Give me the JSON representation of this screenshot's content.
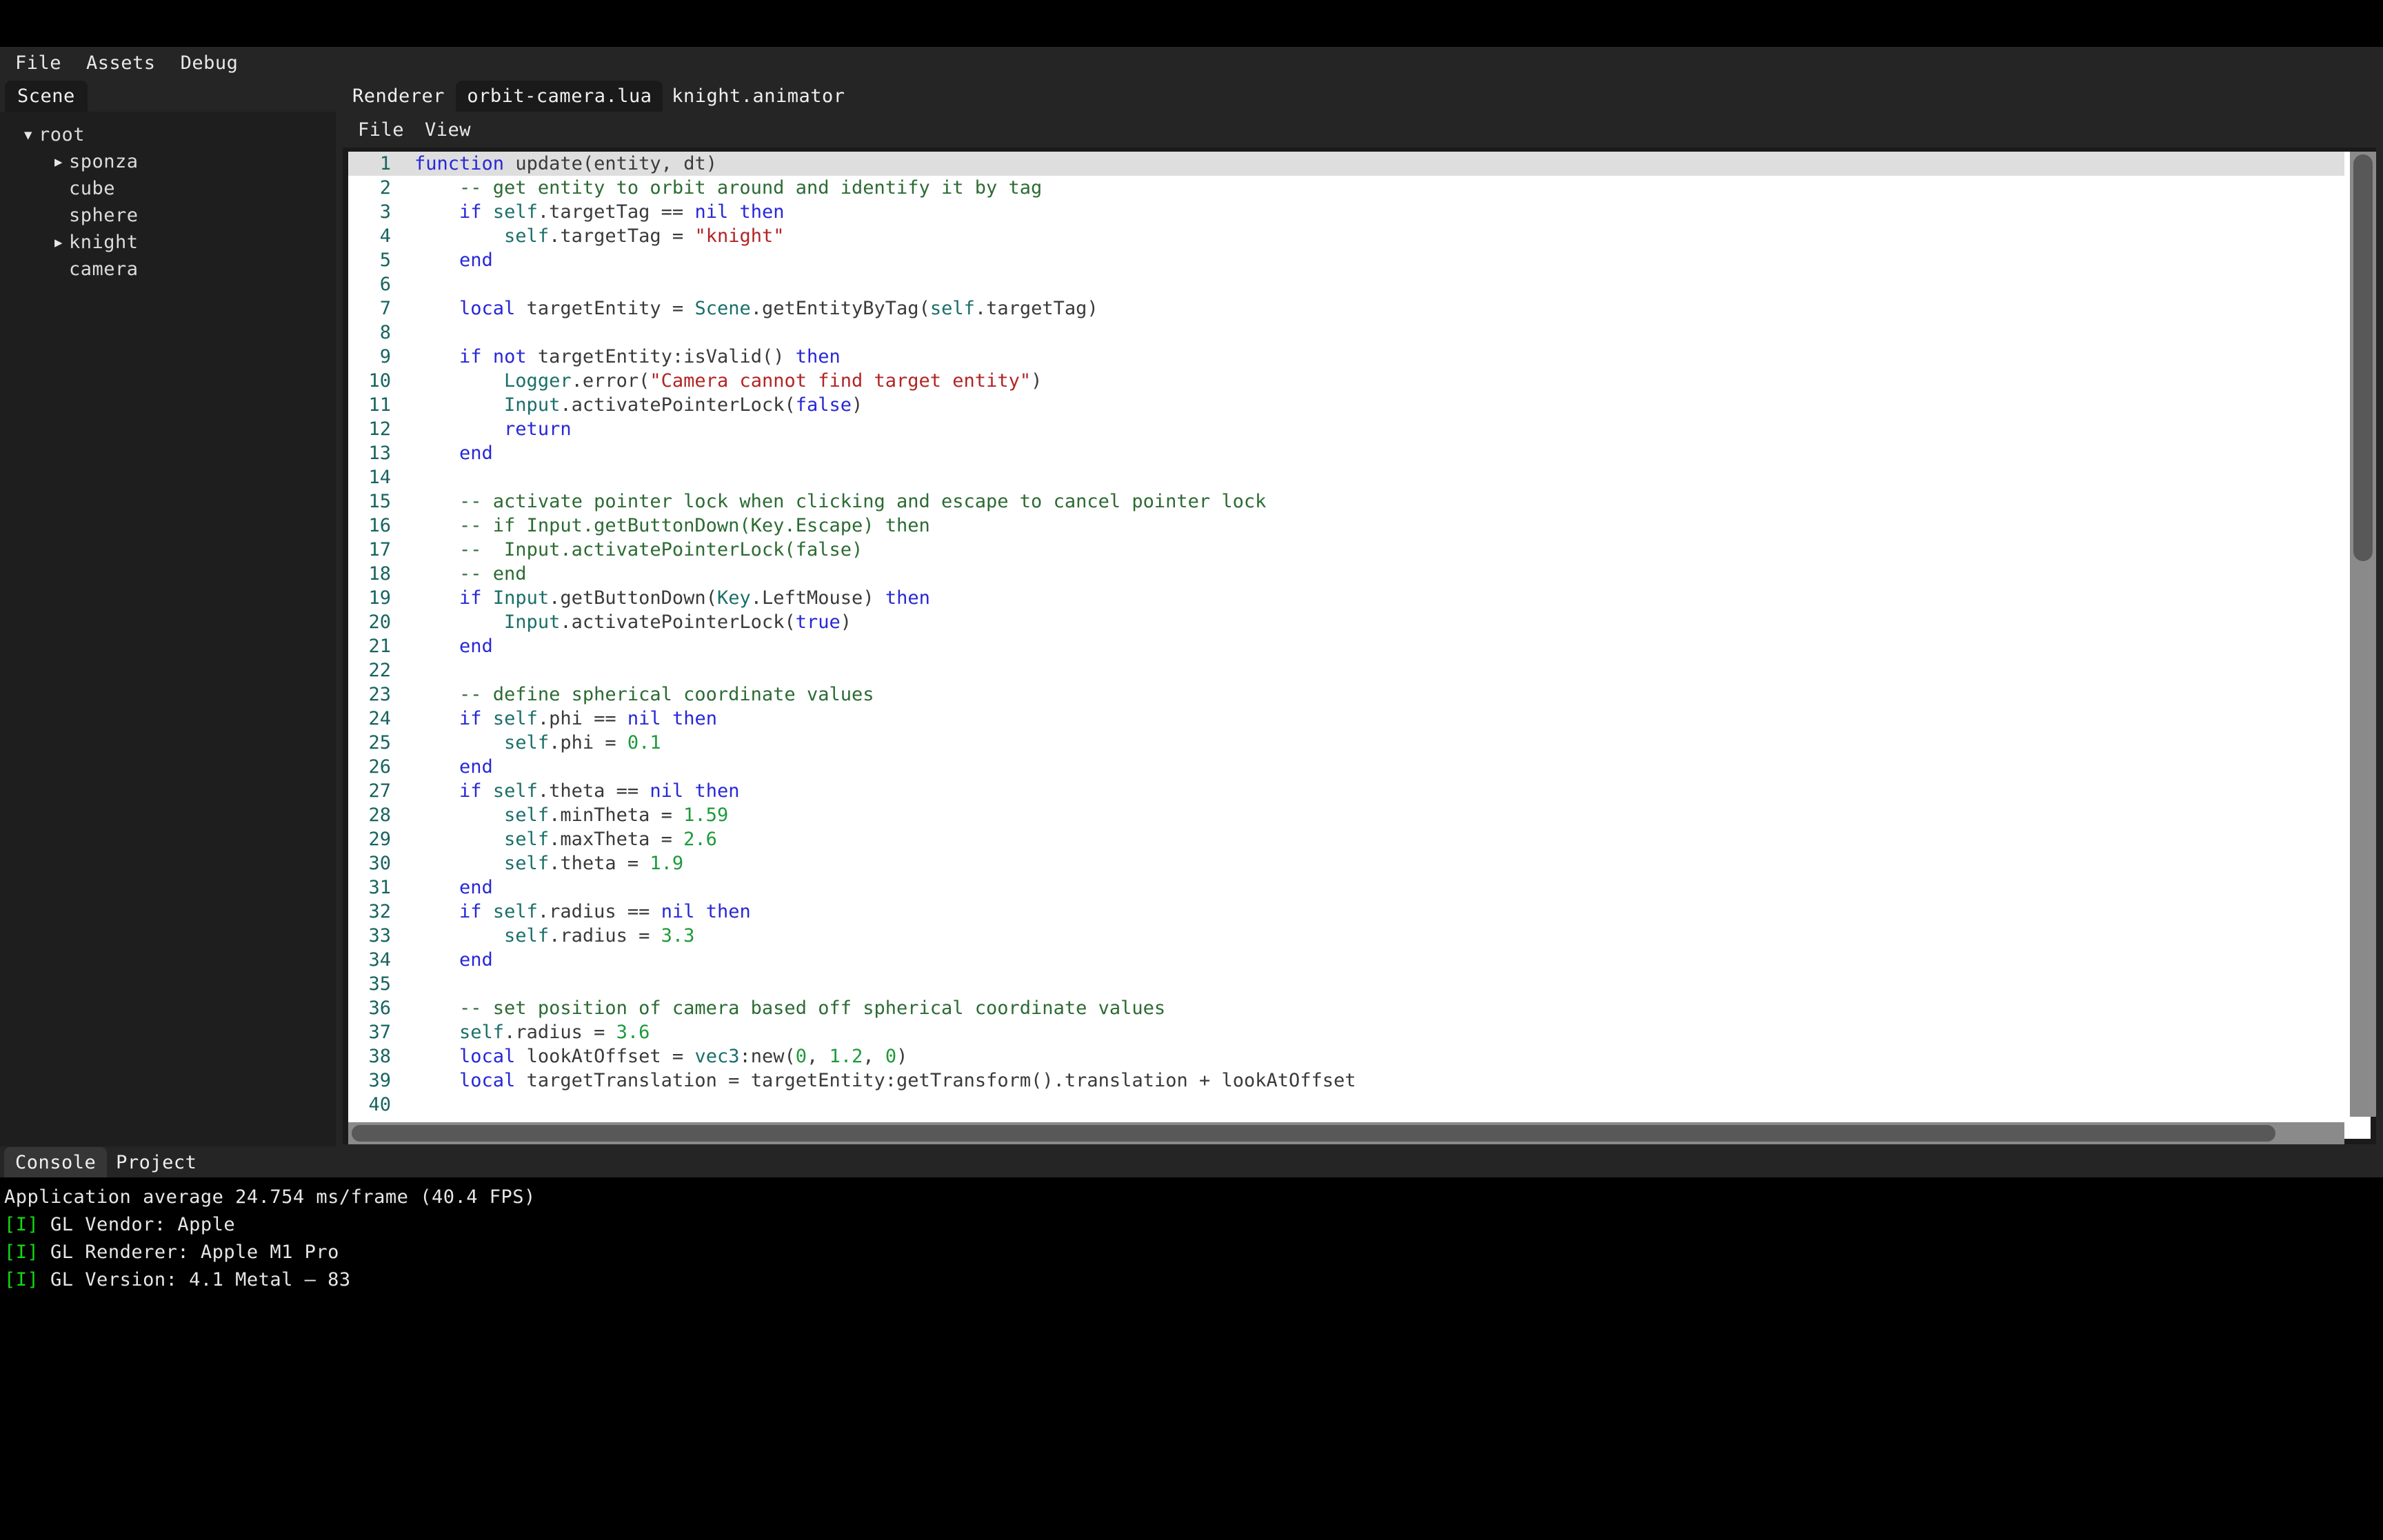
{
  "menubar": {
    "items": [
      "File",
      "Assets",
      "Debug"
    ]
  },
  "scene_panel": {
    "tab_label": "Scene",
    "tree": [
      {
        "label": "root",
        "level": 0,
        "twisty": "▼"
      },
      {
        "label": "sponza",
        "level": 1,
        "twisty": "▶"
      },
      {
        "label": "cube",
        "level": 1,
        "twisty": ""
      },
      {
        "label": "sphere",
        "level": 1,
        "twisty": ""
      },
      {
        "label": "knight",
        "level": 1,
        "twisty": "▶"
      },
      {
        "label": "camera",
        "level": 1,
        "twisty": ""
      }
    ]
  },
  "editor_tabs": [
    {
      "label": "Renderer",
      "active": false
    },
    {
      "label": "orbit-camera.lua",
      "active": true
    },
    {
      "label": "knight.animator",
      "active": false
    }
  ],
  "editor_menubar": {
    "items": [
      "File",
      "View"
    ]
  },
  "code": {
    "language": "lua",
    "highlighted_line": 1,
    "colors": {
      "keyword": "#2727d8",
      "comment": "#2c6b33",
      "string": "#b32424",
      "number": "#1d9a3a",
      "identifier": "#1a6f6a",
      "plain": "#3a3a3a",
      "gutter": "#17645f",
      "background": "#ffffff",
      "line_highlight": "#dedede"
    },
    "lines": [
      {
        "n": 1,
        "text": "function update(entity, dt)"
      },
      {
        "n": 2,
        "text": "    -- get entity to orbit around and identify it by tag"
      },
      {
        "n": 3,
        "text": "    if self.targetTag == nil then"
      },
      {
        "n": 4,
        "text": "        self.targetTag = \"knight\""
      },
      {
        "n": 5,
        "text": "    end"
      },
      {
        "n": 6,
        "text": ""
      },
      {
        "n": 7,
        "text": "    local targetEntity = Scene.getEntityByTag(self.targetTag)"
      },
      {
        "n": 8,
        "text": ""
      },
      {
        "n": 9,
        "text": "    if not targetEntity:isValid() then"
      },
      {
        "n": 10,
        "text": "        Logger.error(\"Camera cannot find target entity\")"
      },
      {
        "n": 11,
        "text": "        Input.activatePointerLock(false)"
      },
      {
        "n": 12,
        "text": "        return"
      },
      {
        "n": 13,
        "text": "    end"
      },
      {
        "n": 14,
        "text": ""
      },
      {
        "n": 15,
        "text": "    -- activate pointer lock when clicking and escape to cancel pointer lock"
      },
      {
        "n": 16,
        "text": "    -- if Input.getButtonDown(Key.Escape) then"
      },
      {
        "n": 17,
        "text": "    --  Input.activatePointerLock(false)"
      },
      {
        "n": 18,
        "text": "    -- end"
      },
      {
        "n": 19,
        "text": "    if Input.getButtonDown(Key.LeftMouse) then"
      },
      {
        "n": 20,
        "text": "        Input.activatePointerLock(true)"
      },
      {
        "n": 21,
        "text": "    end"
      },
      {
        "n": 22,
        "text": ""
      },
      {
        "n": 23,
        "text": "    -- define spherical coordinate values"
      },
      {
        "n": 24,
        "text": "    if self.phi == nil then"
      },
      {
        "n": 25,
        "text": "        self.phi = 0.1"
      },
      {
        "n": 26,
        "text": "    end"
      },
      {
        "n": 27,
        "text": "    if self.theta == nil then"
      },
      {
        "n": 28,
        "text": "        self.minTheta = 1.59"
      },
      {
        "n": 29,
        "text": "        self.maxTheta = 2.6"
      },
      {
        "n": 30,
        "text": "        self.theta = 1.9"
      },
      {
        "n": 31,
        "text": "    end"
      },
      {
        "n": 32,
        "text": "    if self.radius == nil then"
      },
      {
        "n": 33,
        "text": "        self.radius = 3.3"
      },
      {
        "n": 34,
        "text": "    end"
      },
      {
        "n": 35,
        "text": ""
      },
      {
        "n": 36,
        "text": "    -- set position of camera based off spherical coordinate values"
      },
      {
        "n": 37,
        "text": "    self.radius = 3.6"
      },
      {
        "n": 38,
        "text": "    local lookAtOffset = vec3:new(0, 1.2, 0)"
      },
      {
        "n": 39,
        "text": "    local targetTranslation = targetEntity:getTransform().translation + lookAtOffset"
      },
      {
        "n": 40,
        "text": ""
      }
    ]
  },
  "console": {
    "tabs": [
      {
        "label": "Console",
        "active": true
      },
      {
        "label": "Project",
        "active": false
      }
    ],
    "lines": [
      {
        "tag": "",
        "text": "Application average 24.754 ms/frame (40.4 FPS)"
      },
      {
        "tag": "[I]",
        "text": " GL Vendor: Apple"
      },
      {
        "tag": "[I]",
        "text": " GL Renderer: Apple M1 Pro"
      },
      {
        "tag": "[I]",
        "text": " GL Version: 4.1 Metal – 83"
      }
    ]
  }
}
